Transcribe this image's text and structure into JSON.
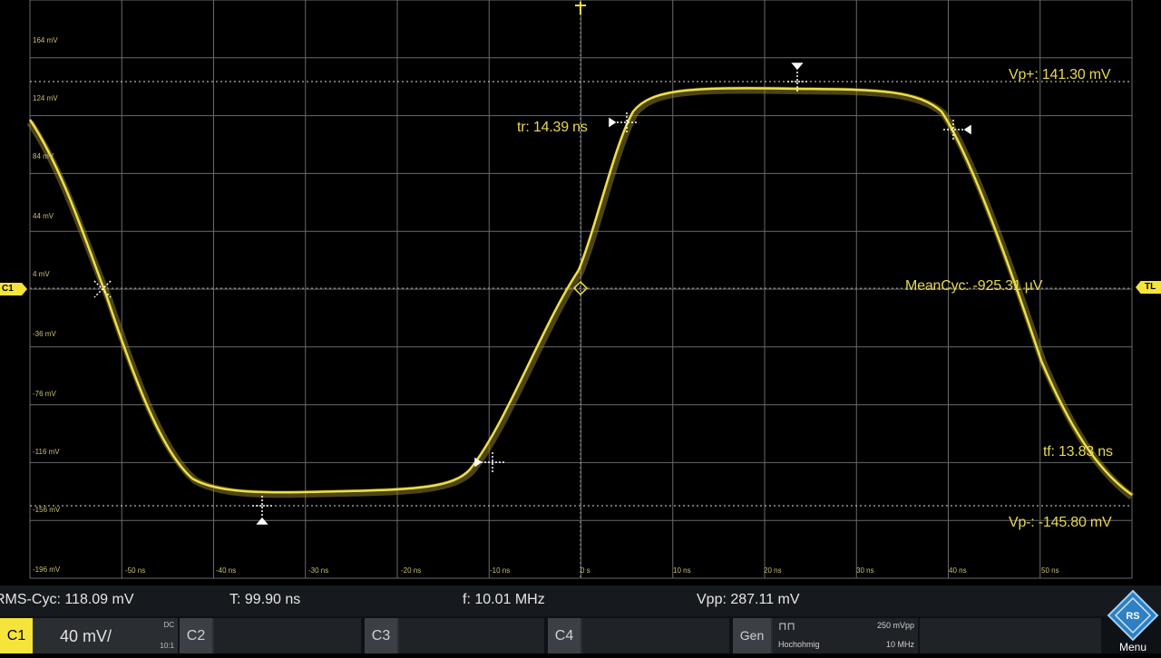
{
  "scope": {
    "channel_flag": "C1",
    "trigger_flag": "TL",
    "y_axis_labels": [
      "164 mV",
      "124 mV",
      "84 mV",
      "44 mV",
      "4 mV",
      "-36 mV",
      "-76 mV",
      "-116 mV",
      "-156 mV",
      "-196 mV"
    ],
    "x_axis_labels": [
      "-50 ns",
      "-40 ns",
      "-30 ns",
      "-20 ns",
      "-10 ns",
      "0 s",
      "10 ns",
      "20 ns",
      "30 ns",
      "40 ns",
      "50 ns"
    ]
  },
  "measurements": {
    "vp_plus": "Vp+: 141.30 mV",
    "vp_minus": "Vp-: -145.80 mV",
    "tr": "tr: 14.39 ns",
    "tf": "tf: 13.83 ns",
    "mean": "MeanCyc: -925.31 µV"
  },
  "stats": {
    "rms": "RMS-Cyc: 118.09 mV",
    "period": "T: 99.90 ns",
    "freq": "f: 10.01 MHz",
    "vpp": "Vpp: 287.11 mV"
  },
  "channels": {
    "c1": {
      "label": "C1",
      "scale": "40 mV/",
      "coupling": "DC",
      "probe": "10:1"
    },
    "c2": {
      "label": "C2"
    },
    "c3": {
      "label": "C3"
    },
    "c4": {
      "label": "C4"
    },
    "gen": {
      "label": "Gen",
      "amplitude": "250 mVpp",
      "load": "Hochohmig",
      "freq": "10 MHz"
    }
  },
  "menu_label": "Menu",
  "colors": {
    "trace": "#e8d850",
    "background": "#000000",
    "grid": "#6a6a6a"
  }
}
